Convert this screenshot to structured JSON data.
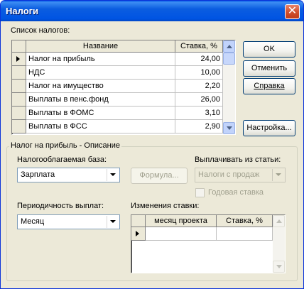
{
  "window": {
    "title": "Налоги",
    "close_glyph": "✕"
  },
  "tax_list": {
    "label": "Список налогов:",
    "columns": {
      "name": "Название",
      "rate": "Ставка, %"
    },
    "rows": [
      {
        "name": "Налог на прибыль",
        "rate": "24,00"
      },
      {
        "name": "НДС",
        "rate": "10,00"
      },
      {
        "name": "Налог на имущество",
        "rate": "2,20"
      },
      {
        "name": "Выплаты в пенс.фонд",
        "rate": "26,00"
      },
      {
        "name": "Выплаты в ФОМС",
        "rate": "3,10"
      },
      {
        "name": "Выплаты в ФСС",
        "rate": "2,90"
      }
    ]
  },
  "buttons": {
    "ok": "OK",
    "cancel": "Отменить",
    "help": "Справка",
    "settings": "Настройка...",
    "formula": "Формула..."
  },
  "description": {
    "group_title": "Налог на прибыль - Описание",
    "tax_base_label": "Налогооблагаемая база:",
    "tax_base_value": "Зарплата",
    "pay_from_label": "Выплачивать из статьи:",
    "pay_from_value": "Налоги с продаж",
    "annual_rate_label": "Годовая ставка",
    "periodicity_label": "Периодичность выплат:",
    "periodicity_value": "Месяц",
    "rate_changes_label": "Изменения ставки:",
    "rate_changes_columns": {
      "month": "месяц проекта",
      "rate": "Ставка, %"
    }
  },
  "colors": {
    "title_bar": "#0054e3",
    "window_bg": "#ece9d8",
    "button_border": "#003c74"
  }
}
